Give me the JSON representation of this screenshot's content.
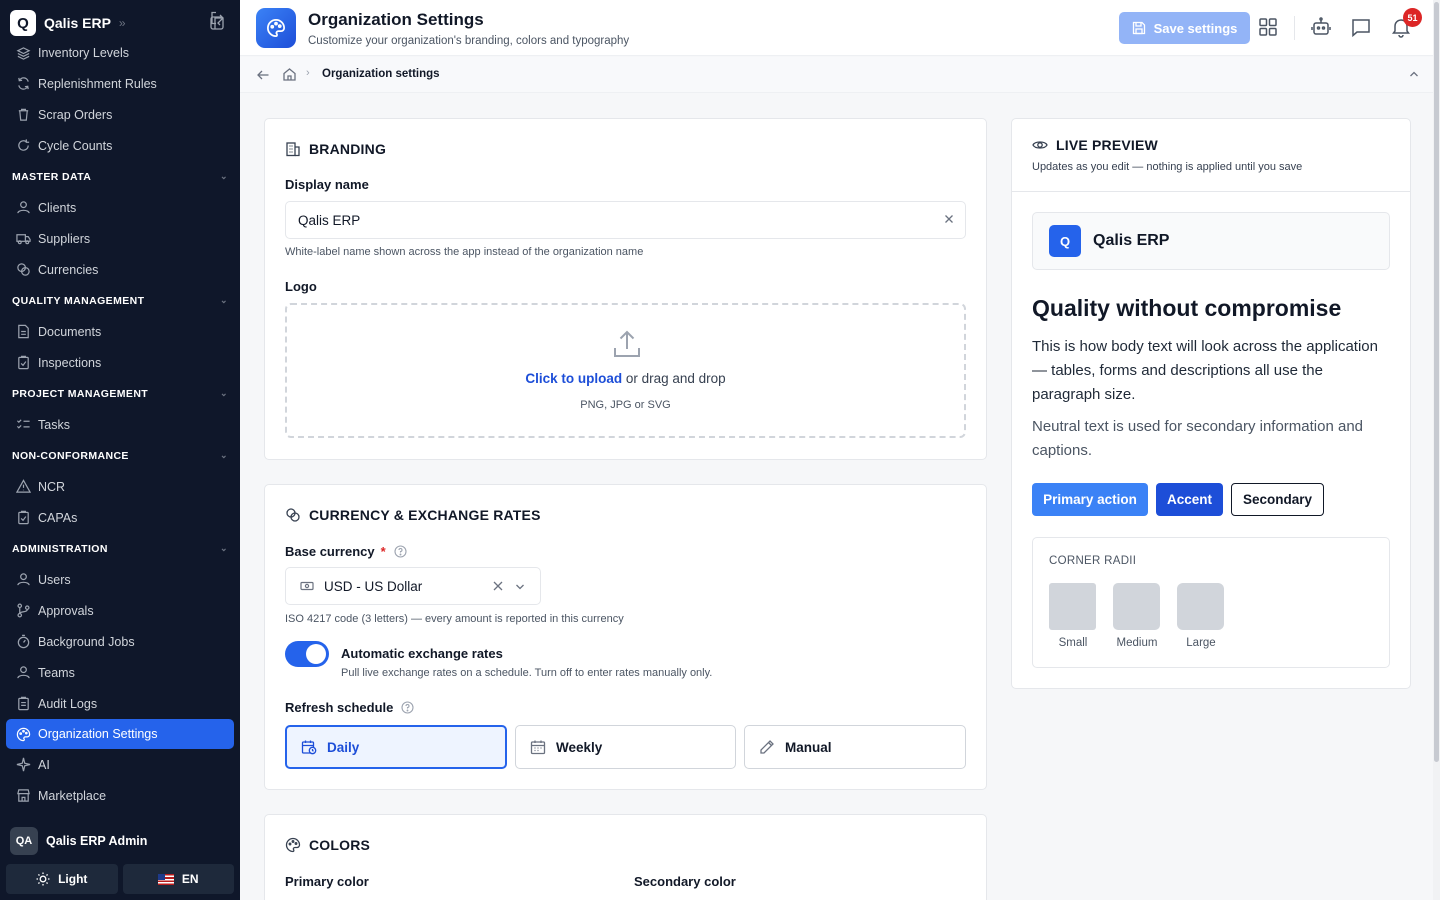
{
  "app": {
    "name": "Qalis ERP",
    "logo_letter": "Q"
  },
  "sidebar": {
    "top_items": [
      "Inventory Levels",
      "Replenishment Rules",
      "Scrap Orders",
      "Cycle Counts"
    ],
    "sections": [
      {
        "title": "MASTER DATA",
        "items": [
          "Clients",
          "Suppliers",
          "Currencies"
        ]
      },
      {
        "title": "QUALITY MANAGEMENT",
        "items": [
          "Documents",
          "Inspections"
        ]
      },
      {
        "title": "PROJECT MANAGEMENT",
        "items": [
          "Tasks"
        ]
      },
      {
        "title": "NON-CONFORMANCE",
        "items": [
          "NCR",
          "CAPAs"
        ]
      },
      {
        "title": "ADMINISTRATION",
        "items": [
          "Users",
          "Approvals",
          "Background Jobs",
          "Teams",
          "Audit Logs",
          "Organization Settings",
          "AI",
          "Marketplace"
        ]
      }
    ],
    "active_item": "Organization Settings",
    "user": {
      "initials": "QA",
      "name": "Qalis ERP Admin"
    },
    "theme_label": "Light",
    "language_label": "EN"
  },
  "header": {
    "title": "Organization Settings",
    "subtitle": "Customize your organization's branding, colors and typography",
    "save_label": "Save settings",
    "notification_count": "51"
  },
  "breadcrumb": {
    "current": "Organization settings"
  },
  "branding": {
    "title": "BRANDING",
    "display_name_label": "Display name",
    "display_name_value": "Qalis ERP",
    "display_name_hint": "White-label name shown across the app instead of the organization name",
    "logo_label": "Logo",
    "upload_link": "Click to upload",
    "upload_text": " or drag and drop",
    "upload_hint": "PNG, JPG or SVG"
  },
  "currency": {
    "title": "CURRENCY & EXCHANGE RATES",
    "base_label": "Base currency",
    "required_mark": "*",
    "base_value": "USD - US Dollar",
    "base_hint": "ISO 4217 code (3 letters) — every amount is reported in this currency",
    "auto_label": "Automatic exchange rates",
    "auto_hint": "Pull live exchange rates on a schedule. Turn off to enter rates manually only.",
    "auto_enabled": true,
    "schedule_label": "Refresh schedule",
    "schedule_options": [
      "Daily",
      "Weekly",
      "Manual"
    ],
    "schedule_selected": "Daily"
  },
  "colors": {
    "title": "COLORS",
    "primary_label": "Primary color",
    "secondary_label": "Secondary color"
  },
  "preview": {
    "title": "LIVE PREVIEW",
    "subtitle": "Updates as you edit — nothing is applied until you save",
    "brand_name": "Qalis ERP",
    "heading": "Quality without compromise",
    "body": "This is how body text will look across the application — tables, forms and descriptions all use the paragraph size.",
    "muted": "Neutral text is used for secondary information and captions.",
    "buttons": {
      "primary": "Primary action",
      "accent": "Accent",
      "secondary": "Secondary"
    },
    "radii_title": "CORNER RADII",
    "radii": [
      "Small",
      "Medium",
      "Large"
    ]
  },
  "theme_colors": {
    "sidebar_bg": "#0f172a",
    "accent": "#2563eb",
    "primary_button": "#3b82f6",
    "accent_button": "#1d4ed8",
    "badge": "#dc2626"
  }
}
